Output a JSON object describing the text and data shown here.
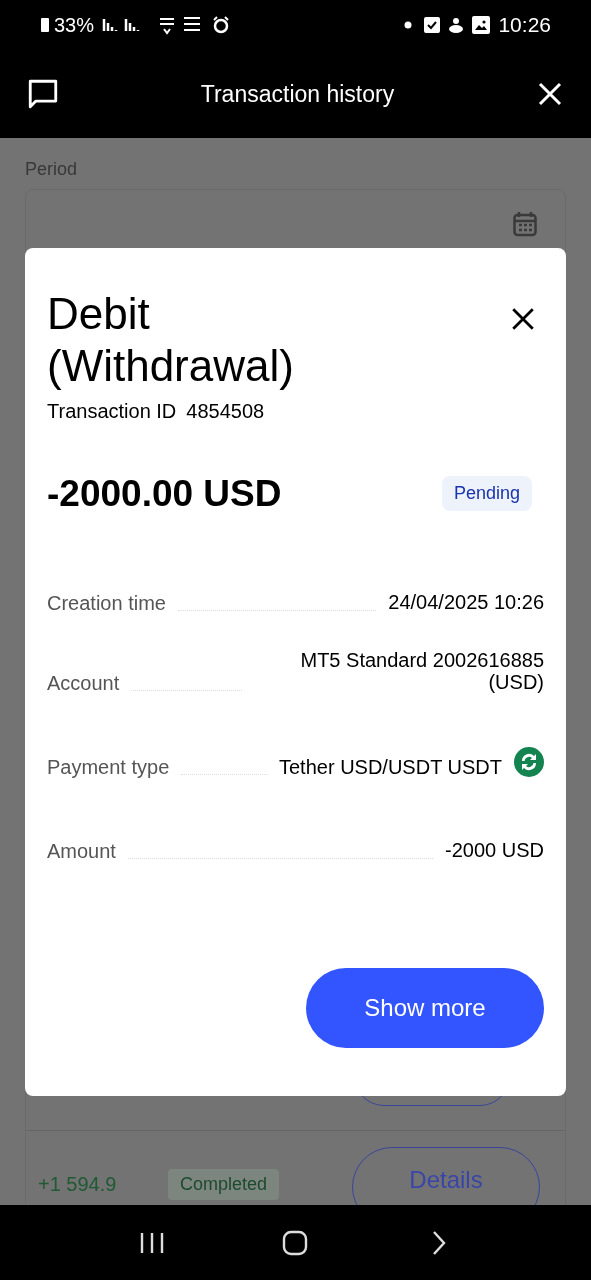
{
  "status_bar": {
    "battery": "33%",
    "time": "10:26"
  },
  "header": {
    "title": "Transaction history"
  },
  "filter": {
    "label": "Period"
  },
  "background_row": {
    "amount": "+1 594.9",
    "status": "Completed",
    "button": "Details"
  },
  "dialog": {
    "title": "Debit (Withdrawal)",
    "transaction_id_label": "Transaction ID",
    "transaction_id": "4854508",
    "amount": "-2000.00 USD",
    "status": "Pending",
    "details": [
      {
        "label": "Creation time",
        "value": "24/04/2025 10:26",
        "kind": "text"
      },
      {
        "label": "Account",
        "value": "MT5 Standard 2002616885 (USD)",
        "kind": "text"
      },
      {
        "label": "Payment type",
        "value": "Tether USD/USDT USDT",
        "kind": "payment"
      },
      {
        "label": "Amount",
        "value": "-2000 USD",
        "kind": "text"
      }
    ],
    "button": "Show more"
  }
}
